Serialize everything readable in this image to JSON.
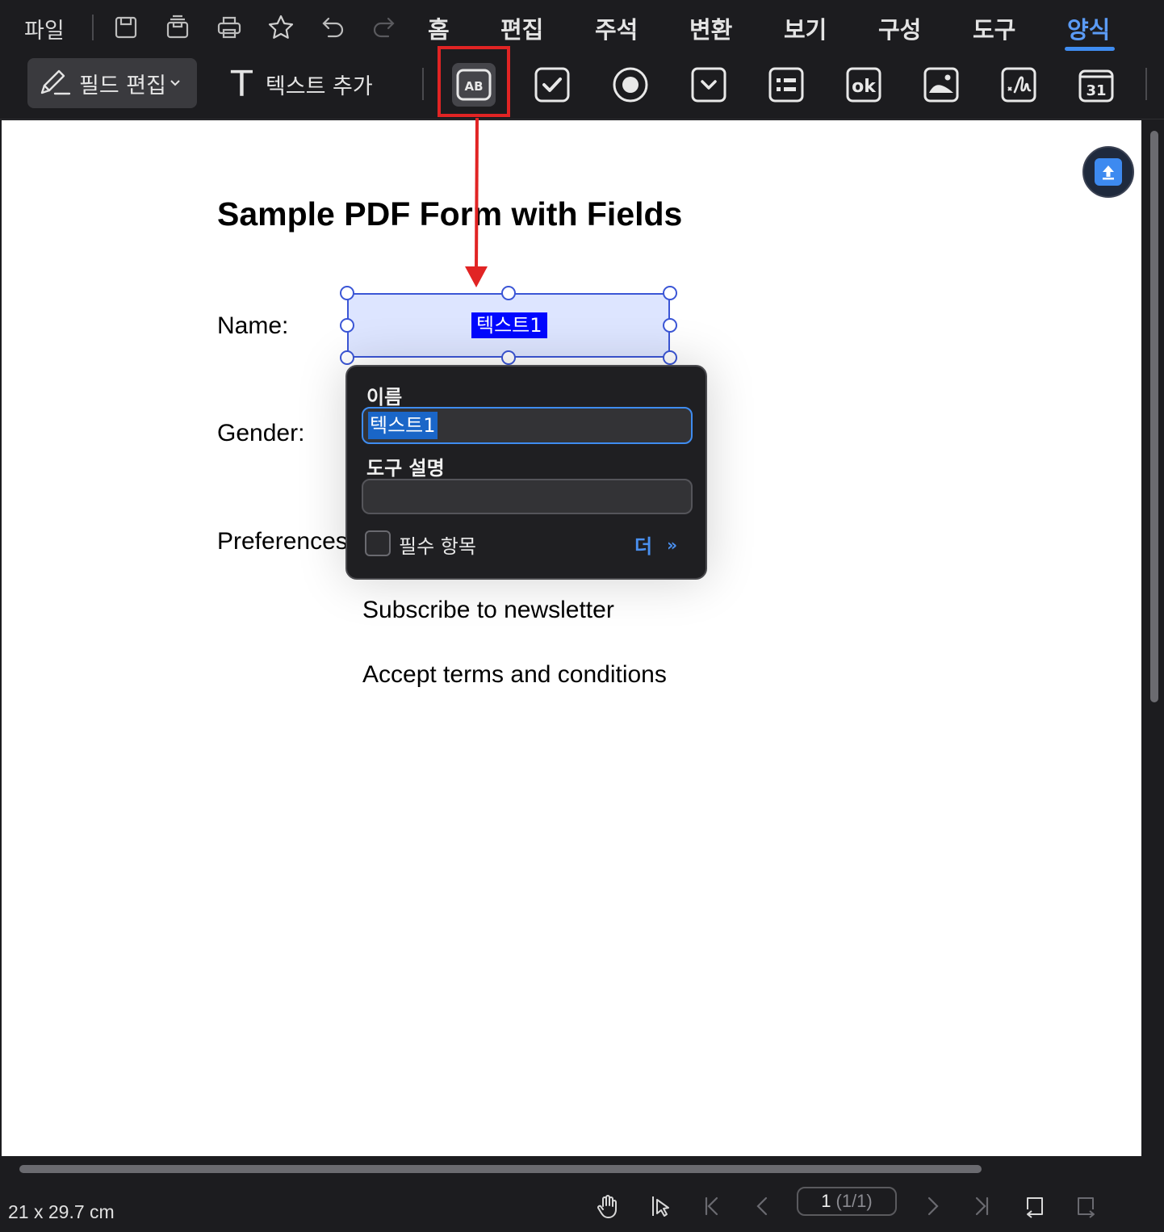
{
  "menu": {
    "file_label": "파일",
    "quick_icons": [
      "save-icon",
      "save-as-icon",
      "print-icon",
      "star-icon",
      "undo-icon",
      "redo-icon"
    ],
    "tabs": [
      {
        "label": "홈"
      },
      {
        "label": "편집"
      },
      {
        "label": "주석"
      },
      {
        "label": "변환"
      },
      {
        "label": "보기"
      },
      {
        "label": "구성"
      },
      {
        "label": "도구"
      },
      {
        "label": "양식"
      }
    ],
    "active_tab": "양식"
  },
  "toolbar": {
    "field_edit_label": "필드 편집",
    "add_text_label": "텍스트 추가",
    "text_glyph": "T",
    "form_tools": [
      "text-field-tool-icon",
      "checkbox-tool-icon",
      "radio-button-tool-icon",
      "dropdown-tool-icon",
      "list-box-tool-icon",
      "button-tool-icon",
      "image-field-tool-icon",
      "signature-field-tool-icon",
      "date-field-tool-icon"
    ],
    "text_field_icon_text": "AB",
    "button_icon_text": "ok",
    "date_icon_text": "31"
  },
  "document": {
    "title": "Sample PDF Form with Fields",
    "labels": {
      "name": "Name:",
      "gender": "Gender:",
      "preferences": "Preferences:",
      "subscribe": "Subscribe to newsletter",
      "accept": "Accept terms and conditions"
    },
    "text_field_name": "텍스트1"
  },
  "popup": {
    "name_label": "이름",
    "name_value": "텍스트1",
    "tooltip_label": "도구 설명",
    "tooltip_value": "",
    "required_label": "필수 항목",
    "required_checked": false,
    "more_label": "더",
    "more_chevron": "»"
  },
  "statusbar": {
    "page_size": "21 x 29.7 cm",
    "current_page": "1",
    "page_total": "(1/1)"
  },
  "colors": {
    "accent": "#3f8cf0",
    "highlight_red": "#e12424",
    "field_fill": "#dde5ff",
    "field_border": "#3b56d6",
    "dark_bg": "#1c1c1f"
  }
}
